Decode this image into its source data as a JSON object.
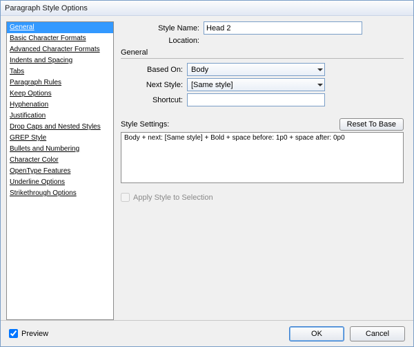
{
  "title": "Paragraph Style Options",
  "sidebar": {
    "selected_index": 0,
    "items": [
      "General",
      "Basic Character Formats",
      "Advanced Character Formats",
      "Indents and Spacing",
      "Tabs",
      "Paragraph Rules",
      "Keep Options",
      "Hyphenation",
      "Justification",
      "Drop Caps and Nested Styles",
      "GREP Style",
      "Bullets and Numbering",
      "Character Color",
      "OpenType Features",
      "Underline Options",
      "Strikethrough Options"
    ]
  },
  "fields": {
    "style_name": {
      "label": "Style Name:",
      "value": "Head 2"
    },
    "location": {
      "label": "Location:"
    },
    "based_on": {
      "label": "Based On:",
      "value": "Body"
    },
    "next_style": {
      "label": "Next Style:",
      "value": "[Same style]"
    },
    "shortcut": {
      "label": "Shortcut:",
      "value": ""
    }
  },
  "section": {
    "general": "General"
  },
  "style_settings": {
    "label": "Style Settings:",
    "reset_label": "Reset To Base",
    "summary": "Body + next: [Same style] + Bold + space before: 1p0 + space after: 0p0"
  },
  "apply_to_selection": {
    "label": "Apply Style to Selection",
    "checked": false,
    "enabled": false
  },
  "footer": {
    "preview": {
      "label": "Preview",
      "checked": true
    },
    "ok": "OK",
    "cancel": "Cancel"
  }
}
